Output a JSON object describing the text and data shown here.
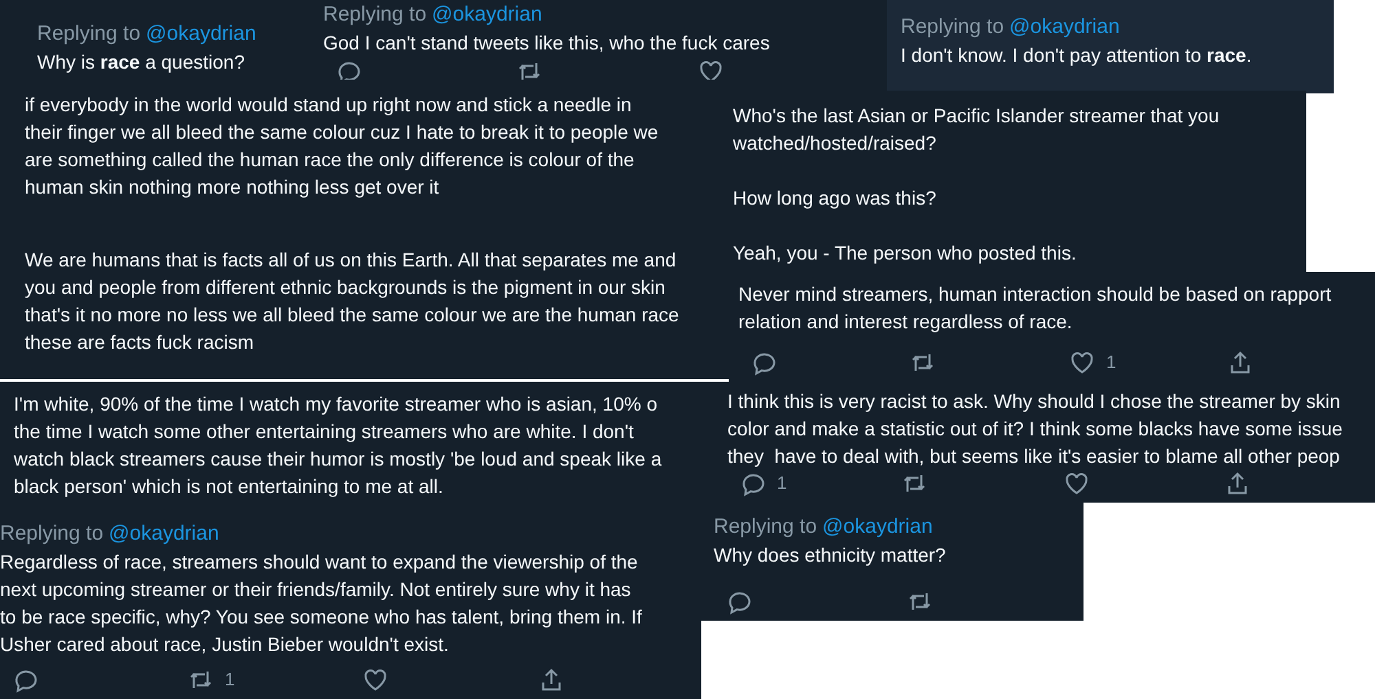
{
  "pieces": [
    {
      "highlighted": false,
      "reply_to": {
        "label": "Replying to",
        "handle": "@okaydrian"
      },
      "paragraphs": [
        [
          "Why is **race** a question?"
        ]
      ]
    },
    {
      "highlighted": false,
      "reply_to": {
        "label": "Replying to",
        "handle": "@okaydrian"
      },
      "paragraphs": [
        [
          "God I can't stand tweets like this, who the fuck cares"
        ]
      ],
      "actions": [
        {
          "kind": "reply"
        },
        {
          "kind": "retweet"
        },
        {
          "kind": "like"
        }
      ]
    },
    {
      "highlighted": true,
      "reply_to": {
        "label": "Replying to",
        "handle": "@okaydrian"
      },
      "paragraphs": [
        [
          "I don't know. I don't pay attention to **race**."
        ]
      ]
    },
    {
      "highlighted": false,
      "paragraphs": [
        [
          "if everybody in the world would stand up right now and stick a needle in",
          "their finger we all bleed the same colour cuz I hate to break it to people we",
          "are something called the human race the only difference is colour of the",
          "human skin nothing more nothing less get over it"
        ]
      ]
    },
    {
      "highlighted": false,
      "paragraphs": [
        [
          "Who's the last Asian or Pacific Islander streamer that you",
          "watched/hosted/raised?"
        ],
        [
          "How long ago was this?"
        ],
        [
          "Yeah, you - The person who posted this."
        ]
      ]
    },
    {
      "highlighted": false,
      "paragraphs": [
        [
          "We are humans that is facts all of us on this Earth. All that separates me and",
          "you and people from different ethnic backgrounds is the pigment in our skin",
          "that's it no more no less we all bleed the same colour we are the human race",
          "these are facts fuck racism"
        ]
      ]
    },
    {
      "highlighted": false,
      "paragraphs": [
        [
          "Never mind streamers, human interaction should be based on rapport",
          "relation and interest regardless of race."
        ]
      ],
      "actions": [
        {
          "kind": "reply"
        },
        {
          "kind": "retweet"
        },
        {
          "kind": "like",
          "count": "1"
        },
        {
          "kind": "share"
        }
      ]
    },
    {
      "highlighted": false,
      "paragraphs": [
        [
          "I'm white, 90% of the time I watch my favorite streamer who is asian, 10% o",
          "the time I watch some other entertaining streamers who are white. I don't",
          "watch black streamers cause their humor is mostly 'be loud and speak like a",
          "black person' which is not entertaining to me at all."
        ]
      ]
    },
    {
      "highlighted": false,
      "paragraphs": [
        [
          "I think this is very racist to ask. Why should I chose the streamer by skin",
          "color and make a statistic out of it? I think some blacks have some issue",
          "they  have to deal with, but seems like it's easier to blame all other peop"
        ]
      ],
      "actions": [
        {
          "kind": "reply",
          "count": "1"
        },
        {
          "kind": "retweet"
        },
        {
          "kind": "like"
        },
        {
          "kind": "share"
        }
      ]
    },
    {
      "highlighted": false,
      "reply_to": {
        "label": "Replying to",
        "handle": "@okaydrian"
      },
      "paragraphs": [
        [
          "Regardless of race, streamers should want to expand the viewership of the",
          "next upcoming streamer or their friends/family. Not entirely sure why it has",
          "to be race specific, why? You see someone who has talent, bring them in. If",
          "Usher cared about race, Justin Bieber wouldn't exist."
        ]
      ],
      "actions": [
        {
          "kind": "reply"
        },
        {
          "kind": "retweet",
          "count": "1"
        },
        {
          "kind": "like"
        },
        {
          "kind": "share"
        }
      ]
    },
    {
      "highlighted": false,
      "reply_to": {
        "label": "Replying to",
        "handle": "@okaydrian"
      },
      "paragraphs": [
        [
          "Why does ethnicity matter?"
        ]
      ],
      "actions": [
        {
          "kind": "reply"
        },
        {
          "kind": "retweet"
        }
      ]
    }
  ]
}
